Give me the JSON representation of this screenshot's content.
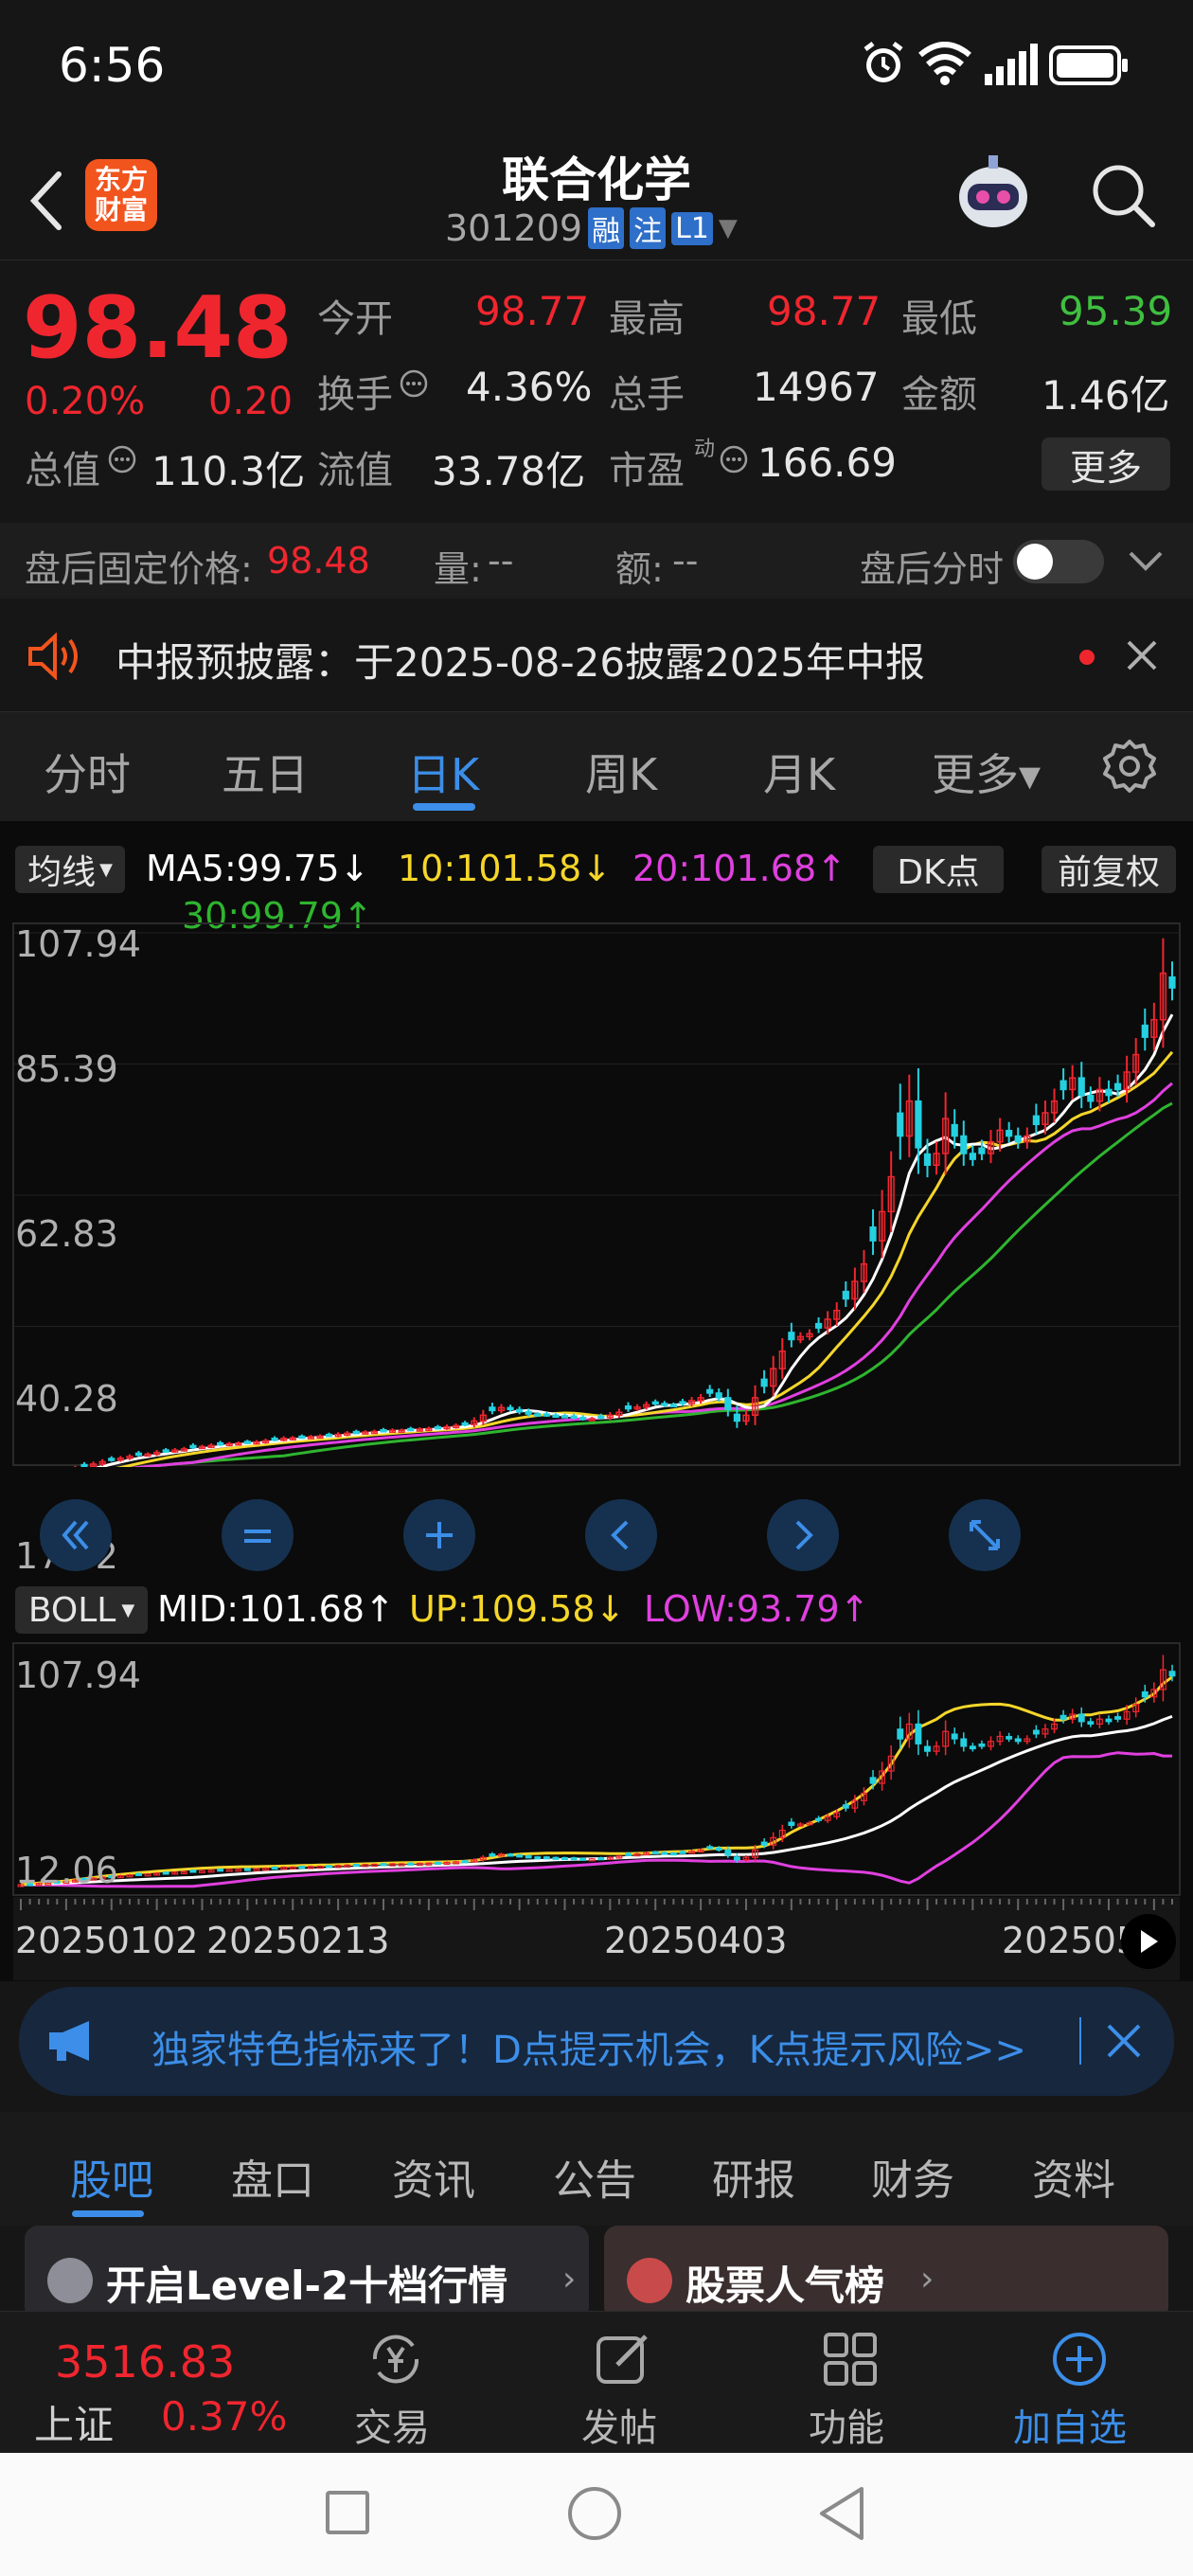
{
  "status_bar": {
    "time": "6:56"
  },
  "header": {
    "brand_line1": "东方",
    "brand_line2": "财富",
    "stock_name": "联合化学",
    "stock_code": "301209",
    "tag_rong": "融",
    "tag_zhu": "注",
    "tag_level": "L1"
  },
  "quote": {
    "price": "98.48",
    "change_pct": "0.20%",
    "change_abs": "0.20",
    "open_label": "今开",
    "open_value": "98.77",
    "high_label": "最高",
    "high_value": "98.77",
    "low_label": "最低",
    "low_value": "95.39",
    "turnover_label": "换手",
    "turnover_value": "4.36%",
    "volume_label": "总手",
    "volume_value": "14967",
    "amount_label": "金额",
    "amount_value": "1.46亿",
    "mktcap_label": "总值",
    "mktcap_value": "110.3亿",
    "float_label": "流值",
    "float_value": "33.78亿",
    "pe_label": "市盈",
    "pe_super": "动",
    "pe_value": "166.69",
    "more_label": "更多"
  },
  "after_hours": {
    "price_label": "盘后固定价格:",
    "price_value": "98.48",
    "vol_label": "量:",
    "vol_value": "--",
    "amt_label": "额:",
    "amt_value": "--",
    "timeshare_label": "盘后分时"
  },
  "notice": {
    "text": "中报预披露：于2025-08-26披露2025年中报"
  },
  "period_tabs": [
    "分时",
    "五日",
    "日K",
    "周K",
    "月K",
    "更多▾"
  ],
  "ma_bar": {
    "selector": "均线",
    "ma5": "MA5:99.75↓",
    "ma10": "10:101.58↓",
    "ma20": "20:101.68↑",
    "ma30": "30:99.79↑",
    "dk_button": "DK点",
    "adjust_button": "前复权"
  },
  "main_axis": {
    "labels": [
      "107.94",
      "85.39",
      "62.83",
      "40.28",
      "17.72"
    ]
  },
  "boll_bar": {
    "selector": "BOLL",
    "mid": "MID:101.68↑",
    "up": "UP:109.58↓",
    "low": "LOW:93.79↑"
  },
  "boll_axis": {
    "top": "107.94",
    "bottom": "12.06"
  },
  "date_axis": [
    "20250102",
    "20250213",
    "20250403",
    "202505"
  ],
  "colors": {
    "up": "#f0262f",
    "down": "#25d0e0",
    "ma5": "#ffffff",
    "ma10": "#f5d62a",
    "ma20": "#e040e0",
    "ma30": "#2fb52f",
    "accent": "#3c8ee8"
  },
  "chart_data": {
    "type": "candlestick",
    "ma_lines": [
      "MA5",
      "MA10",
      "MA20",
      "MA30"
    ],
    "ylim": [
      17.72,
      107.94
    ],
    "boll_ylim": [
      12.06,
      107.94
    ],
    "close": [
      14,
      14.2,
      14.5,
      14.6,
      15,
      15.3,
      15.8,
      16.2,
      16.6,
      17,
      17.3,
      17.6,
      17.9,
      18.2,
      18.3,
      18.6,
      18.8,
      19,
      19.2,
      19.5,
      19.6,
      19.8,
      20,
      20.1,
      20.2,
      20.3,
      20.4,
      20.6,
      20.8,
      21,
      21.1,
      21.2,
      21.3,
      21.4,
      21.5,
      21.7,
      21.9,
      22,
      22.1,
      22.2,
      22.3,
      22.4,
      22.4,
      22.5,
      22.6,
      22.7,
      22.8,
      23,
      23.2,
      23.4,
      24,
      25,
      25.8,
      26.3,
      26,
      25.6,
      25.2,
      25.1,
      25,
      24.9,
      24.8,
      24.6,
      24.4,
      24.4,
      24.6,
      25,
      25.5,
      26.1,
      26.4,
      26.8,
      27,
      26.8,
      26.7,
      27,
      27.5,
      28,
      28.8,
      28,
      26,
      24,
      25,
      28,
      30,
      33,
      36,
      38,
      38.5,
      39,
      40,
      41.5,
      43,
      45,
      48,
      51,
      55,
      60,
      66,
      73,
      79,
      71,
      68,
      70,
      76,
      73,
      70,
      69,
      70,
      72,
      74,
      73,
      72,
      73,
      75,
      77,
      79,
      81,
      83,
      80,
      79,
      81,
      80,
      81,
      84,
      87,
      90,
      93,
      101,
      98.48
    ]
  },
  "banner": {
    "text": "独家特色指标来了！D点提示机会，K点提示风险>>"
  },
  "bottom_tabs": [
    "股吧",
    "盘口",
    "资讯",
    "公告",
    "研报",
    "财务",
    "资料"
  ],
  "promo": {
    "left": "开启Level-2十档行情",
    "right": "股票人气榜"
  },
  "bottom_nav": {
    "index_value": "3516.83",
    "index_name": "上证",
    "index_pct": "0.37%",
    "trade": "交易",
    "post": "发帖",
    "features": "功能",
    "add_watch": "加自选"
  }
}
